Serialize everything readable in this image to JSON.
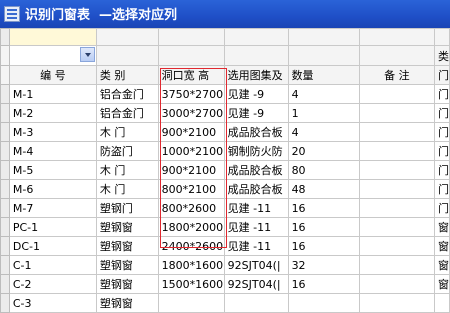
{
  "window": {
    "title": "识别门窗表  —选择对应列",
    "app_icon": "table-icon"
  },
  "selection_row": {
    "dropdown_icon": "chevron-down-icon"
  },
  "top_right_label": "类",
  "headers": {
    "num": "编 号",
    "type": "类 别",
    "size": "洞口宽 高",
    "atlas": "选用图集及",
    "qty": "数量",
    "note": "备 注",
    "extra": "门"
  },
  "rows": [
    {
      "num": "M-1",
      "type": "铝合金门",
      "size": "3750*2700",
      "atlas": "见建 -9",
      "qty": "4",
      "note": "",
      "extra": "门"
    },
    {
      "num": "M-2",
      "type": "铝合金门",
      "size": "3000*2700",
      "atlas": "见建 -9",
      "qty": "1",
      "note": "",
      "extra": "门"
    },
    {
      "num": "M-3",
      "type": "木 门",
      "size": "900*2100",
      "atlas": "成品胶合板",
      "qty": "4",
      "note": "",
      "extra": "门"
    },
    {
      "num": "M-4",
      "type": "防盗门",
      "size": "1000*2100",
      "atlas": "钢制防火防",
      "qty": "20",
      "note": "",
      "extra": "门"
    },
    {
      "num": "M-5",
      "type": "木 门",
      "size": "900*2100",
      "atlas": "成品胶合板",
      "qty": "80",
      "note": "",
      "extra": "门"
    },
    {
      "num": "M-6",
      "type": "木 门",
      "size": "800*2100",
      "atlas": "成品胶合板",
      "qty": "48",
      "note": "",
      "extra": "门"
    },
    {
      "num": "M-7",
      "type": "塑钢门",
      "size": "800*2600",
      "atlas": "见建 -11",
      "qty": "16",
      "note": "",
      "extra": "门"
    },
    {
      "num": "PC-1",
      "type": "塑钢窗",
      "size": "1800*2000",
      "atlas": "见建 -11",
      "qty": "16",
      "note": "",
      "extra": "窗"
    },
    {
      "num": "DC-1",
      "type": "塑钢窗",
      "size": "2400*2600",
      "atlas": "见建 -11",
      "qty": "16",
      "note": "",
      "extra": "窗"
    },
    {
      "num": "C-1",
      "type": "塑钢窗",
      "size": "1800*1600",
      "atlas": "92SJT04(|",
      "qty": "32",
      "note": "",
      "extra": "窗"
    },
    {
      "num": "C-2",
      "type": "塑钢窗",
      "size": "1500*1600",
      "atlas": "92SJT04(|",
      "qty": "16",
      "note": "",
      "extra": "窗"
    },
    {
      "num": "C-3",
      "type": "塑钢窗",
      "size": "",
      "atlas": "",
      "qty": "",
      "note": "",
      "extra": ""
    }
  ],
  "colors": {
    "title_bar": "#1f4fc7",
    "highlight_border": "#e0282f",
    "header_bg": "#f4f4f4",
    "active_cell": "#fff9d8"
  }
}
